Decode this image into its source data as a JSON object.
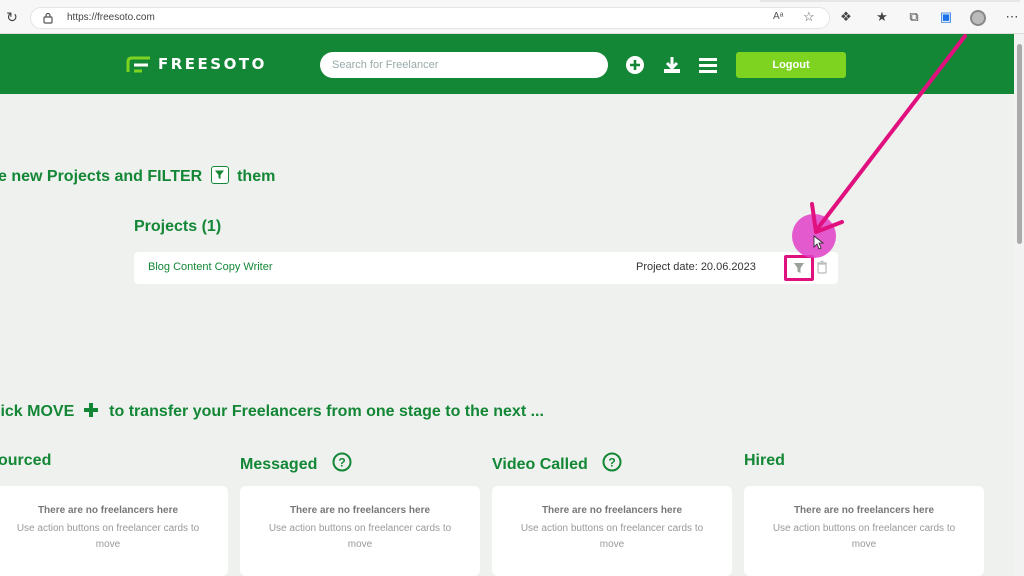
{
  "browser": {
    "url": "https://freesoto.com",
    "reader_label": "Aᵃ"
  },
  "header": {
    "logo_text": "FREESOTO",
    "search_placeholder": "Search for Freelancer",
    "logout_label": "Logout",
    "icons": [
      "add-circle-icon",
      "download-icon",
      "hamburger-menu-icon"
    ]
  },
  "intro": {
    "headline_start": "e new Projects and FILTER",
    "headline_end": "them"
  },
  "projects": {
    "title": "Projects (1)",
    "items": [
      {
        "name": "Blog Content Copy Writer",
        "date": "Project date: 20.06.2023"
      }
    ]
  },
  "move": {
    "headline_start": "lick MOVE",
    "headline_end": "to transfer your Freelancers from one stage to the next ..."
  },
  "stages": [
    {
      "title": "ourced",
      "empty": "There are no freelancers here",
      "hint": "Use action buttons on freelancer cards to move"
    },
    {
      "title": "Messaged",
      "empty": "There are no freelancers here",
      "hint": "Use action buttons on freelancer cards to move"
    },
    {
      "title": "Video Called",
      "empty": "There are no freelancers here",
      "hint": "Use action buttons on freelancer cards to move"
    },
    {
      "title": "Hired",
      "empty": "There are no freelancers here",
      "hint": "Use action buttons on freelancer cards to move"
    }
  ],
  "colors": {
    "brand_green": "#138736",
    "logout_green": "#7ed321",
    "annotation_pink": "#e0117f",
    "background": "#eef1ee"
  }
}
